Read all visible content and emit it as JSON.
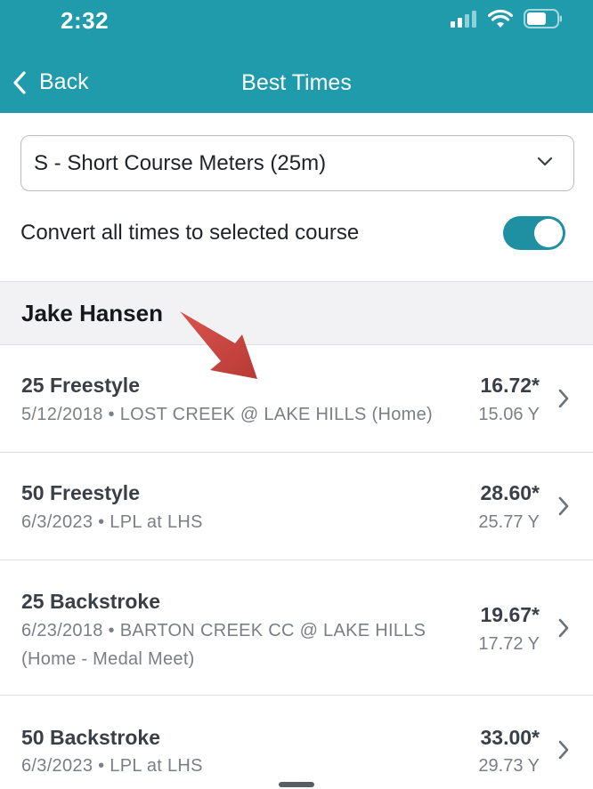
{
  "status_bar": {
    "time": "2:32"
  },
  "nav": {
    "back_label": "Back",
    "title": "Best Times"
  },
  "course_select": {
    "value": "S - Short Course Meters (25m)"
  },
  "convert": {
    "label": "Convert all times to selected course",
    "enabled": true
  },
  "swimmer": {
    "name": "Jake Hansen"
  },
  "rows": [
    {
      "event": "25 Freestyle",
      "meet_line1": "5/12/2018 • LOST CREEK @ LAKE HILLS (Home)",
      "meet_line2": "",
      "time": "16.72*",
      "converted": "15.06 Y"
    },
    {
      "event": "50 Freestyle",
      "meet_line1": "6/3/2023 • LPL at LHS",
      "meet_line2": "",
      "time": "28.60*",
      "converted": "25.77 Y"
    },
    {
      "event": "25 Backstroke",
      "meet_line1": "6/23/2018 • BARTON CREEK CC @ LAKE HILLS",
      "meet_line2": "(Home - Medal Meet)",
      "time": "19.67*",
      "converted": "17.72 Y"
    },
    {
      "event": "50 Backstroke",
      "meet_line1": "6/3/2023 • LPL at LHS",
      "meet_line2": "",
      "time": "33.00*",
      "converted": "29.73 Y"
    }
  ],
  "colors": {
    "header": "#1f9bab",
    "toggle": "#1f8fa2",
    "arrow": "#c8423d"
  }
}
